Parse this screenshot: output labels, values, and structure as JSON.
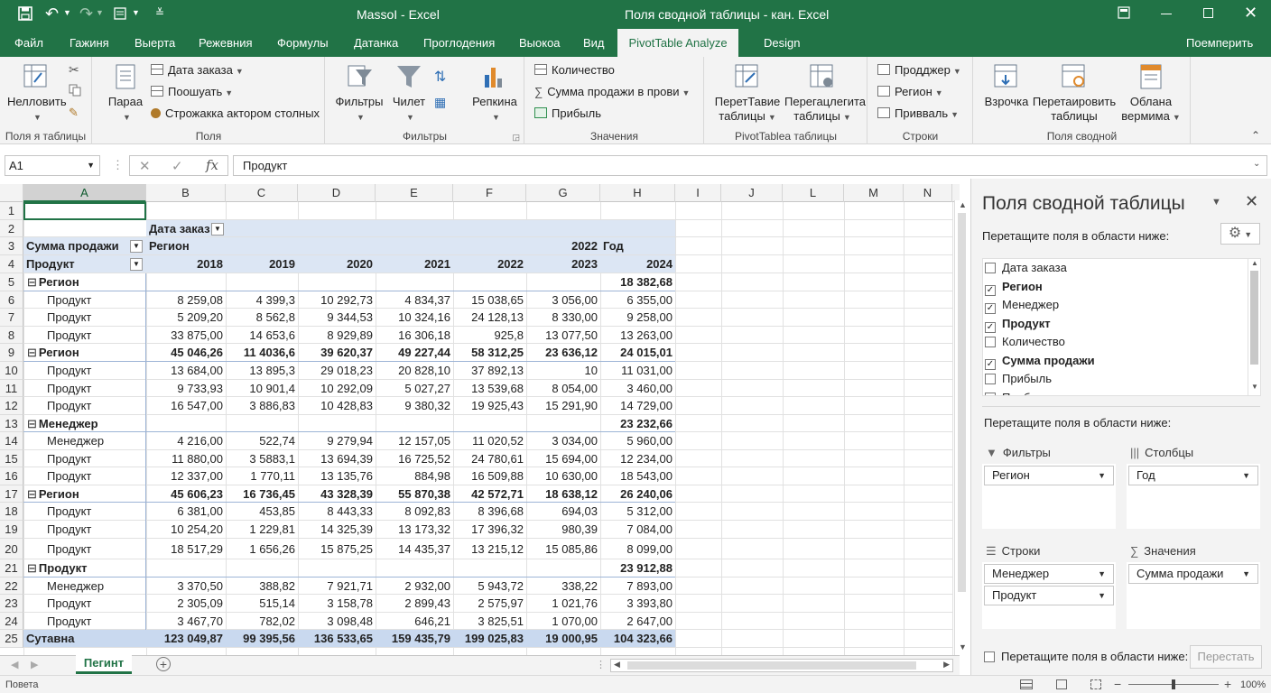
{
  "titlebar": {
    "doc_title": "MassoI - Excel",
    "ctx_title": "Поля сводной таблицы - кан. Excel"
  },
  "tabs": {
    "file": "Файл",
    "t1": "Гажиня",
    "t2": "Выерта",
    "t3": "Режевния",
    "t4": "Формулы",
    "t5": "Датанка",
    "t6": "Проглодения",
    "t7": "Выокоа",
    "t8": "Вид",
    "analyze": "PivotTable Analyze",
    "design": "Design",
    "share": "Поемперить"
  },
  "ribbon": {
    "g1": {
      "btn": "Нелловить",
      "label": "Поля я таблицы"
    },
    "g2": {
      "big": "Параа",
      "s1": "Дата заказа",
      "s2": "Поошуать",
      "s3": "Строжакка актором столных",
      "label": "Поля"
    },
    "g3": {
      "b1": "Фильтры",
      "b2": "Чилет",
      "label": "Фильтры"
    },
    "g4": {
      "big": "Репкина",
      "s1": "Количество",
      "s2": "Сумма продажи в прови",
      "s3": "Прибыль",
      "label": "Значения"
    },
    "g5": {
      "b1a": "ПеретТавие",
      "b1b": "таблицы",
      "b2a": "Перегацлегита",
      "b2b": "таблицы",
      "label": "PivotTablea таблицы"
    },
    "g6": {
      "s1": "Продджер",
      "s2": "Регион",
      "s3": "Привваль",
      "label": "Строки"
    },
    "g7": {
      "b1": "Взрочка",
      "b2a": "Перетаировить",
      "b2b": "таблицы",
      "b3a": "Облана",
      "b3b": "вермима",
      "label": "Поля сводной"
    }
  },
  "formula": {
    "namebox": "A1",
    "content": "Продукт"
  },
  "columns": [
    "A",
    "B",
    "C",
    "D",
    "E",
    "F",
    "G",
    "H",
    "I",
    "J",
    "L",
    "M",
    "N"
  ],
  "pivot": {
    "r2_b": "Дата заказ",
    "r3_a": "Сумма продажи",
    "r3_b": "Регион",
    "r3_g": "2022",
    "r3_h": "Год",
    "r4_a": "Продукт",
    "years": [
      "2018",
      "2019",
      "2020",
      "2021",
      "2022",
      "2023",
      "2024"
    ]
  },
  "rows": [
    {
      "n": "5",
      "label": "Регион",
      "group": true,
      "v": [
        "",
        "",
        "",
        "",
        "",
        "",
        "18 382,68"
      ]
    },
    {
      "n": "6",
      "label": "Продукт",
      "v": [
        "8 259,08",
        "4 399,3",
        "10 292,73",
        "4 834,37",
        "15 038,65",
        "3 056,00",
        "6 355,00"
      ]
    },
    {
      "n": "7",
      "label": "Продукт",
      "v": [
        "5 209,20",
        "8 562,8",
        "9 344,53",
        "10 324,16",
        "24 128,13",
        "8 330,00",
        "9 258,00"
      ]
    },
    {
      "n": "8",
      "label": "Продукт",
      "v": [
        "33 875,00",
        "14 653,6",
        "8 929,89",
        "16 306,18",
        "925,8",
        "13 077,50",
        "13 263,00"
      ]
    },
    {
      "n": "9",
      "label": "Регион",
      "group": true,
      "v": [
        "45 046,26",
        "11 4036,6",
        "39 620,37",
        "49 227,44",
        "58 312,25",
        "23 636,12",
        "24 015,01"
      ]
    },
    {
      "n": "10",
      "label": "Продукт",
      "v": [
        "13 684,00",
        "13 895,3",
        "29 018,23",
        "20 828,10",
        "37 892,13",
        "10",
        "11 031,00"
      ]
    },
    {
      "n": "11",
      "label": "Продукт",
      "v": [
        "9 733,93",
        "10 901,4",
        "10 292,09",
        "5 027,27",
        "13 539,68",
        "8 054,00",
        "3 460,00"
      ]
    },
    {
      "n": "12",
      "label": "Продукт",
      "v": [
        "16 547,00",
        "3 886,83",
        "10 428,83",
        "9 380,32",
        "19 925,43",
        "15 291,90",
        "14 729,00"
      ]
    },
    {
      "n": "13",
      "label": "Менеджер",
      "group": true,
      "v": [
        "",
        "",
        "",
        "",
        "",
        "",
        "23 232,66"
      ]
    },
    {
      "n": "14",
      "label": "Менеджер",
      "v": [
        "4 216,00",
        "522,74",
        "9 279,94",
        "12 157,05",
        "11 020,52",
        "3 034,00",
        "5 960,00"
      ]
    },
    {
      "n": "15",
      "label": "Продукт",
      "v": [
        "11 880,00",
        "3 5883,1",
        "13 694,39",
        "16 725,52",
        "24 780,61",
        "15 694,00",
        "12 234,00"
      ]
    },
    {
      "n": "16",
      "label": "Продукт",
      "v": [
        "12 337,00",
        "1 770,11",
        "13 135,76",
        "884,98",
        "16 509,88",
        "10 630,00",
        "18 543,00"
      ]
    },
    {
      "n": "17",
      "label": "Регион",
      "group": true,
      "v": [
        "45 606,23",
        "16 736,45",
        "43 328,39",
        "55 870,38",
        "42 572,71",
        "18 638,12",
        "26 240,06"
      ]
    },
    {
      "n": "18",
      "label": "Продукт",
      "v": [
        "6 381,00",
        "453,85",
        "8 443,33",
        "8 092,83",
        "8 396,68",
        "694,03",
        "5 312,00"
      ]
    },
    {
      "n": "19",
      "label": "Продукт",
      "v": [
        "10 254,20",
        "1 229,81",
        "14 325,39",
        "13 173,32",
        "17 396,32",
        "980,39",
        "7 084,00"
      ]
    },
    {
      "n": "20",
      "label": "Продукт",
      "v": [
        "18 517,29",
        "1 656,26",
        "15 875,25",
        "14 435,37",
        "13 215,12",
        "15 085,86",
        "8 099,00"
      ]
    },
    {
      "n": "21",
      "label": "Продукт",
      "group": true,
      "v": [
        "",
        "",
        "",
        "",
        "",
        "",
        "23 912,88"
      ]
    },
    {
      "n": "22",
      "label": "Менеджер",
      "v": [
        "3 370,50",
        "388,82",
        "7 921,71",
        "2 932,00",
        "5 943,72",
        "338,22",
        "7 893,00"
      ]
    },
    {
      "n": "23",
      "label": "Продукт",
      "v": [
        "2 305,09",
        "515,14",
        "3 158,78",
        "2 899,43",
        "2 575,97",
        "1 021,76",
        "3 393,80"
      ]
    },
    {
      "n": "24",
      "label": "Продукт",
      "v": [
        "3 467,70",
        "782,02",
        "3 098,48",
        "646,21",
        "3 825,51",
        "1 070,00",
        "2 647,00"
      ]
    },
    {
      "n": "25",
      "label": "Сутавна",
      "total": true,
      "v": [
        "123 049,87",
        "99 395,56",
        "136 533,65",
        "159 435,79",
        "199 025,83",
        "19 000,95",
        "104 323,66"
      ]
    }
  ],
  "sheettab": "Пегинт",
  "status": {
    "ready": "Повета",
    "zoom": "100%"
  },
  "panel": {
    "title": "Поля сводной таблицы",
    "drag_hint": "Перетащите поля в области ниже:",
    "fields": [
      {
        "name": "Дата заказа",
        "checked": false,
        "bold": false
      },
      {
        "name": "Регион",
        "checked": true,
        "bold": true
      },
      {
        "name": "Менеджер",
        "checked": true,
        "bold": false
      },
      {
        "name": "Продукт",
        "checked": true,
        "bold": true
      },
      {
        "name": "Количество",
        "checked": false,
        "bold": false
      },
      {
        "name": "Сумма продажи",
        "checked": true,
        "bold": true
      },
      {
        "name": "Прибыль",
        "checked": false,
        "bold": false
      },
      {
        "name": "Прибыль",
        "checked": false,
        "bold": false
      }
    ],
    "areas_hint": "Перетащите поля в области ниже:",
    "filters": "Фильтры",
    "filters_item": "Регион",
    "columns": "Столбцы",
    "columns_item": "Год",
    "rows": "Строки",
    "rows_item1": "Менеджер",
    "rows_item2": "Продукт",
    "values": "Значения",
    "values_item": "Сумма продажи",
    "defer": "Перетащите поля в области ниже:",
    "update": "Перестать"
  },
  "colors": {
    "excel_green": "#217346",
    "pivot_header": "#dce6f4",
    "pivot_total": "#c9d9ef"
  }
}
